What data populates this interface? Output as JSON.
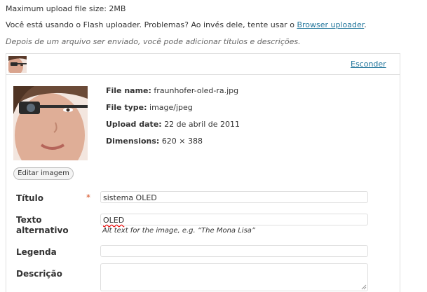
{
  "upload": {
    "max_size": "Maximum upload file size: 2MB",
    "flash_notice": "Você está usando o Flash uploader. Problemas? Ao invés dele, tente usar o",
    "browser_link": "Browser uploader",
    "flash_suffix": ".",
    "after_upload_hint": "Depois de um arquivo ser enviado, você pode adicionar títulos e descrições."
  },
  "item": {
    "toggle_label": "Esconder",
    "meta": {
      "file_name_label": "File name:",
      "file_name": "fraunhofer-oled-ra.jpg",
      "file_type_label": "File type:",
      "file_type": "image/jpeg",
      "upload_date_label": "Upload date:",
      "upload_date": "22 de abril de 2011",
      "dimensions_label": "Dimensions:",
      "dimensions": "620 × 388"
    },
    "edit_image_label": "Editar imagem",
    "fields": {
      "title_label": "Título",
      "required_mark": "*",
      "title_value": "sistema OLED",
      "alt_label_1": "Texto",
      "alt_label_2": "alternativo",
      "alt_value": "OLED",
      "alt_hint": "Alt text for the image, e.g. “The Mona Lisa”",
      "caption_label": "Legenda",
      "caption_value": "",
      "description_label": "Descrição",
      "description_value": ""
    }
  },
  "colors": {
    "link": "#21759b",
    "required": "#d54e21",
    "border": "#dfdfdf"
  }
}
